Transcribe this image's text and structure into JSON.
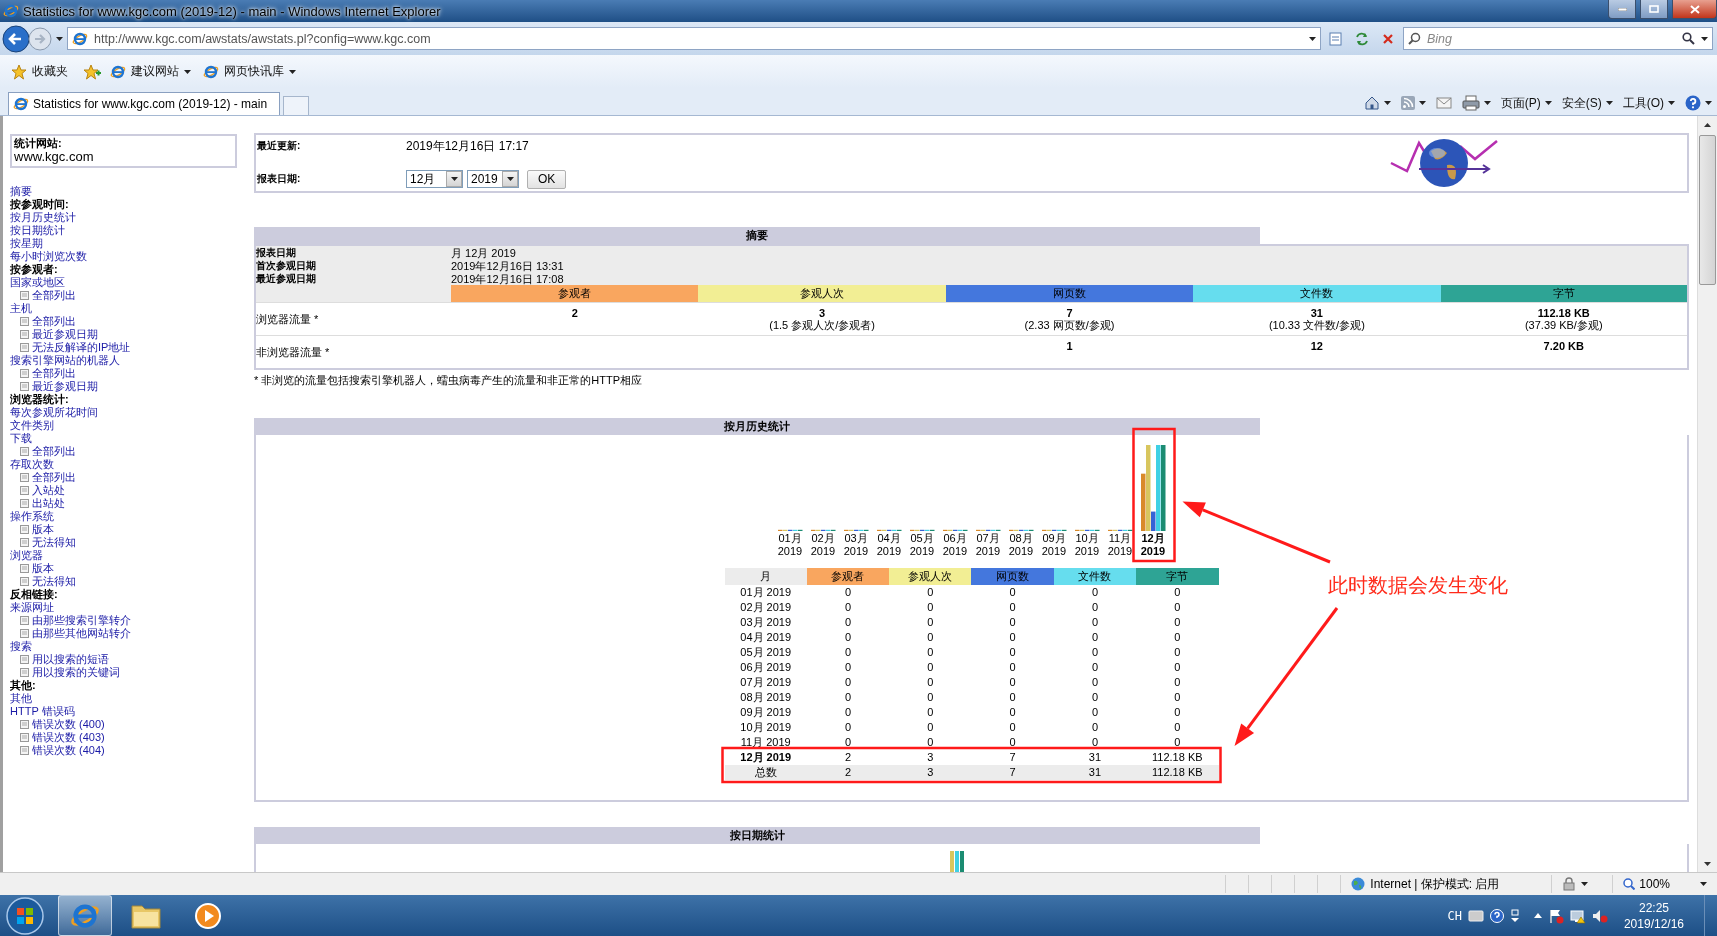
{
  "window": {
    "title": "Statistics for www.kgc.com (2019-12) - main - Windows Internet Explorer"
  },
  "address_bar": {
    "url": "http://www.kgc.com/awstats/awstats.pl?config=www.kgc.com"
  },
  "search": {
    "placeholder": "Bing"
  },
  "favorites_bar": {
    "items": [
      "收藏夹",
      "建议网站",
      "网页快讯库"
    ]
  },
  "tabs": [
    {
      "label": "Statistics for www.kgc.com (2019-12) - main",
      "selected": true
    }
  ],
  "command_bar": {
    "items": [
      "页面(P)",
      "安全(S)",
      "工具(O)"
    ]
  },
  "sidebar": {
    "site_label": "统计网站:",
    "site": "www.kgc.com",
    "entries": [
      {
        "kind": "link",
        "label": "摘要"
      },
      {
        "kind": "heading",
        "label": "按参观时间:"
      },
      {
        "kind": "link",
        "label": "按月历史统计"
      },
      {
        "kind": "link",
        "label": "按日期统计"
      },
      {
        "kind": "link",
        "label": "按星期"
      },
      {
        "kind": "link",
        "label": "每小时浏览次数"
      },
      {
        "kind": "heading",
        "label": "按参观者:"
      },
      {
        "kind": "link",
        "label": "国家或地区",
        "children": [
          {
            "label": "全部列出"
          }
        ]
      },
      {
        "kind": "link",
        "label": "主机",
        "children": [
          {
            "label": "全部列出"
          },
          {
            "label": "最近参观日期"
          },
          {
            "label": "无法反解译的IP地址"
          }
        ]
      },
      {
        "kind": "link",
        "label": "搜索引擎网站的机器人",
        "children": [
          {
            "label": "全部列出"
          },
          {
            "label": "最近参观日期"
          }
        ]
      },
      {
        "kind": "heading",
        "label": "浏览器统计:"
      },
      {
        "kind": "link",
        "label": "每次参观所花时间"
      },
      {
        "kind": "link",
        "label": "文件类别"
      },
      {
        "kind": "link",
        "label": "下载",
        "children": [
          {
            "label": "全部列出"
          }
        ]
      },
      {
        "kind": "link",
        "label": "存取次数",
        "children": [
          {
            "label": "全部列出"
          },
          {
            "label": "入站处"
          },
          {
            "label": "出站处"
          }
        ]
      },
      {
        "kind": "link",
        "label": "操作系统",
        "children": [
          {
            "label": "版本"
          },
          {
            "label": "无法得知"
          }
        ]
      },
      {
        "kind": "link",
        "label": "浏览器",
        "children": [
          {
            "label": "版本"
          },
          {
            "label": "无法得知"
          }
        ]
      },
      {
        "kind": "heading",
        "label": "反相链接:"
      },
      {
        "kind": "link",
        "label": "来源网址",
        "children": [
          {
            "label": "由那些搜索引擎转介"
          },
          {
            "label": "由那些其他网站转介"
          }
        ]
      },
      {
        "kind": "link",
        "label": "搜索",
        "children": [
          {
            "label": "用以搜索的短语"
          },
          {
            "label": "用以搜索的关键词"
          }
        ]
      },
      {
        "kind": "heading",
        "label": "其他:"
      },
      {
        "kind": "link",
        "label": "其他"
      },
      {
        "kind": "link",
        "label": "HTTP 错误码",
        "children": [
          {
            "label": "错误次数 (400)"
          },
          {
            "label": "错误次数 (403)"
          },
          {
            "label": "错误次数 (404)"
          }
        ]
      }
    ]
  },
  "info": {
    "last_update_label": "最近更新:",
    "last_update": "2019年12月16日 17:17",
    "period_label": "报表日期:",
    "month": "12月",
    "year": "2019",
    "ok_button": "OK"
  },
  "summary": {
    "title": "摘要",
    "meta": [
      {
        "label": "报表日期",
        "value": "月 12月 2019"
      },
      {
        "label": "首次参观日期",
        "value": "2019年12月16日 13:31"
      },
      {
        "label": "最近参观日期",
        "value": "2019年12月16日 17:08"
      }
    ],
    "columns": [
      {
        "label": "参观者",
        "color": "#f9a65f"
      },
      {
        "label": "参观人次",
        "color": "#f2ee94"
      },
      {
        "label": "网页数",
        "color": "#4477dd"
      },
      {
        "label": "文件数",
        "color": "#66ddee"
      },
      {
        "label": "字节",
        "color": "#2ea495"
      }
    ],
    "rows": [
      {
        "label": "浏览器流量 *",
        "cells": [
          {
            "value": "2"
          },
          {
            "value": "3",
            "note": "(1.5 参观人次/参观者)"
          },
          {
            "value": "7",
            "note": "(2.33 网页数/参观)"
          },
          {
            "value": "31",
            "note": "(10.33 文件数/参观)"
          },
          {
            "value": "112.18 KB",
            "note": "(37.39 KB/参观)"
          }
        ]
      },
      {
        "label": "非浏览器流量 *",
        "cells": [
          null,
          null,
          {
            "value": "1"
          },
          {
            "value": "12"
          },
          {
            "value": "7.20 KB"
          }
        ]
      }
    ],
    "footnote": "* 非浏览的流量包括搜索引擎机器人，蠕虫病毒产生的流量和非正常的HTTP相应"
  },
  "monthly": {
    "title": "按月历史统计",
    "chart_labels": [
      {
        "month": "01月",
        "year": "2019",
        "current": false
      },
      {
        "month": "02月",
        "year": "2019",
        "current": false
      },
      {
        "month": "03月",
        "year": "2019",
        "current": false
      },
      {
        "month": "04月",
        "year": "2019",
        "current": false
      },
      {
        "month": "05月",
        "year": "2019",
        "current": false
      },
      {
        "month": "06月",
        "year": "2019",
        "current": false
      },
      {
        "month": "07月",
        "year": "2019",
        "current": false
      },
      {
        "month": "08月",
        "year": "2019",
        "current": false
      },
      {
        "month": "09月",
        "year": "2019",
        "current": false
      },
      {
        "month": "10月",
        "year": "2019",
        "current": false
      },
      {
        "month": "11月",
        "year": "2019",
        "current": false
      },
      {
        "month": "12月",
        "year": "2019",
        "current": true
      }
    ],
    "columns": [
      {
        "label": "月"
      },
      {
        "label": "参观者",
        "color": "#f9a65f"
      },
      {
        "label": "参观人次",
        "color": "#f2ee94"
      },
      {
        "label": "网页数",
        "color": "#4477dd"
      },
      {
        "label": "文件数",
        "color": "#66ddee"
      },
      {
        "label": "字节",
        "color": "#2ea495"
      }
    ],
    "rows": [
      {
        "month": "01月 2019",
        "values": [
          "0",
          "0",
          "0",
          "0",
          "0"
        ],
        "current": false
      },
      {
        "month": "02月 2019",
        "values": [
          "0",
          "0",
          "0",
          "0",
          "0"
        ],
        "current": false
      },
      {
        "month": "03月 2019",
        "values": [
          "0",
          "0",
          "0",
          "0",
          "0"
        ],
        "current": false
      },
      {
        "month": "04月 2019",
        "values": [
          "0",
          "0",
          "0",
          "0",
          "0"
        ],
        "current": false
      },
      {
        "month": "05月 2019",
        "values": [
          "0",
          "0",
          "0",
          "0",
          "0"
        ],
        "current": false
      },
      {
        "month": "06月 2019",
        "values": [
          "0",
          "0",
          "0",
          "0",
          "0"
        ],
        "current": false
      },
      {
        "month": "07月 2019",
        "values": [
          "0",
          "0",
          "0",
          "0",
          "0"
        ],
        "current": false
      },
      {
        "month": "08月 2019",
        "values": [
          "0",
          "0",
          "0",
          "0",
          "0"
        ],
        "current": false
      },
      {
        "month": "09月 2019",
        "values": [
          "0",
          "0",
          "0",
          "0",
          "0"
        ],
        "current": false
      },
      {
        "month": "10月 2019",
        "values": [
          "0",
          "0",
          "0",
          "0",
          "0"
        ],
        "current": false
      },
      {
        "month": "11月 2019",
        "values": [
          "0",
          "0",
          "0",
          "0",
          "0"
        ],
        "current": false
      },
      {
        "month": "12月 2019",
        "values": [
          "2",
          "3",
          "7",
          "31",
          "112.18 KB"
        ],
        "current": true
      }
    ],
    "total": {
      "label": "总数",
      "values": [
        "2",
        "3",
        "7",
        "31",
        "112.18 KB"
      ]
    }
  },
  "daily": {
    "title": "按日期统计"
  },
  "annotation": {
    "text": "此时数据会发生变化"
  },
  "status_bar": {
    "zone": "Internet | 保护模式: 启用",
    "zoom": "100%"
  },
  "taskbar": {
    "language": "CH",
    "time": "22:25",
    "date": "2019/12/16"
  }
}
